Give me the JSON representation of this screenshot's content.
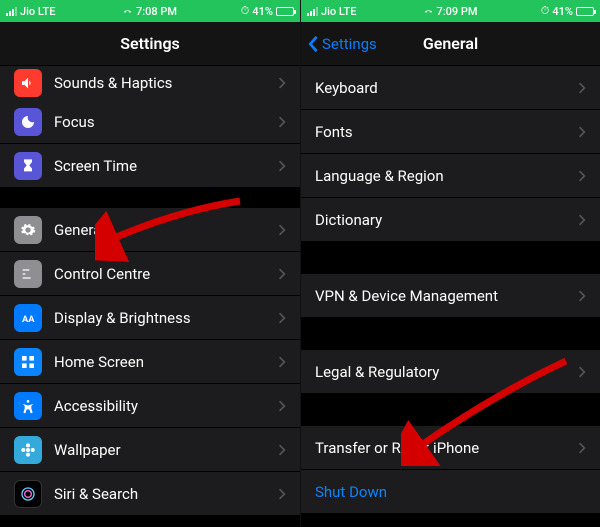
{
  "left": {
    "status": {
      "carrier": "Jio  LTE",
      "time": "7:08 PM",
      "battery": "41%"
    },
    "title": "Settings",
    "rows": {
      "sounds": "Sounds & Haptics",
      "focus": "Focus",
      "screentime": "Screen Time",
      "general": "General",
      "control": "Control Centre",
      "display": "Display & Brightness",
      "home": "Home Screen",
      "access": "Accessibility",
      "wallpaper": "Wallpaper",
      "siri": "Siri & Search"
    }
  },
  "right": {
    "status": {
      "carrier": "Jio  LTE",
      "time": "7:09 PM",
      "battery": "41%"
    },
    "back": "Settings",
    "title": "General",
    "rows": {
      "keyboard": "Keyboard",
      "fonts": "Fonts",
      "lang": "Language & Region",
      "dict": "Dictionary",
      "vpn": "VPN & Device Management",
      "legal": "Legal & Regulatory",
      "transfer": "Transfer or Reset iPhone",
      "shutdown": "Shut Down"
    }
  }
}
